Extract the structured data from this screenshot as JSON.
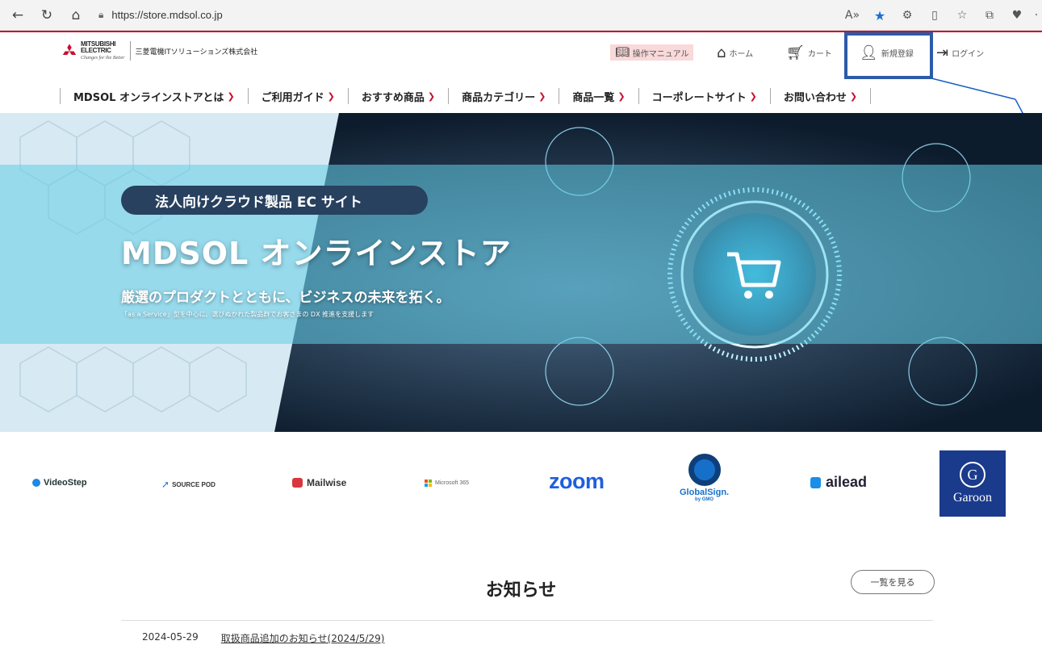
{
  "browser": {
    "url": "https://store.mdsol.co.jp",
    "icons": [
      "back-icon",
      "reload-icon",
      "home-icon",
      "lock-icon",
      "read-aloud-icon",
      "favorite-star-icon",
      "extensions-icon",
      "split-screen-icon",
      "favorites-icon",
      "collections-icon",
      "browser-essentials-icon",
      "more-icon"
    ],
    "star_color": "#1a6fd6"
  },
  "brand": {
    "logo_line1": "MITSUBISHI",
    "logo_line2": "ELECTRIC",
    "tagline": "Changes for the Better",
    "company": "三菱電機ITソリューションズ株式会社",
    "accent": "#c8102e"
  },
  "utility": {
    "manual": "操作マニュアル",
    "home": "ホーム",
    "cart": "カート",
    "register": "新規登録",
    "login": "ログイン"
  },
  "nav": [
    {
      "label": "MDSOL オンラインストアとは"
    },
    {
      "label": "ご利用ガイド"
    },
    {
      "label": "おすすめ商品"
    },
    {
      "label": "商品カテゴリー"
    },
    {
      "label": "商品一覧"
    },
    {
      "label": "コーポレートサイト"
    },
    {
      "label": "お問い合わせ"
    }
  ],
  "hero": {
    "pill": "法人向けクラウド製品 EC サイト",
    "title": "MDSOL オンラインストア",
    "subtitle": "厳選のプロダクトとともに、ビジネスの未来を拓く。",
    "note": "「as a Service」型を中心に、選びぬかれた製品群でお客さまの DX 推進を支援します"
  },
  "partners": {
    "videostep": "VideoStep",
    "sourcepod": "SOURCE POD",
    "mailwise": "Mailwise",
    "microsoft": "Microsoft 365",
    "zoom": "zoom",
    "globalsign": "GlobalSign.",
    "globalsign_by": "by GMO",
    "ailead": "ailead",
    "garoon_g": "G",
    "garoon": "Garoon"
  },
  "news": {
    "title": "お知らせ",
    "more": "一覧を見る",
    "items": [
      {
        "date": "2024-05-29",
        "title": "取扱商品追加のお知らせ(2024/5/29)"
      }
    ]
  }
}
